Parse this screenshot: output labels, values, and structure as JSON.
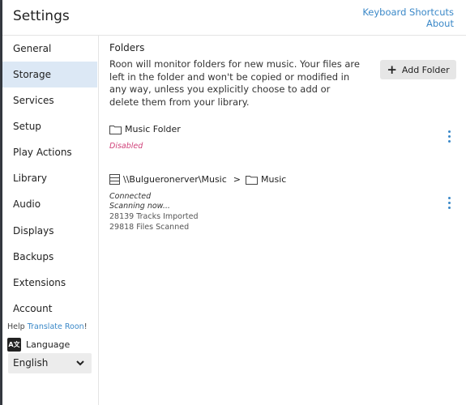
{
  "header": {
    "title": "Settings",
    "keyboard_shortcuts": "Keyboard Shortcuts",
    "about": "About"
  },
  "sidebar": {
    "items": [
      {
        "label": "General",
        "active": false
      },
      {
        "label": "Storage",
        "active": true
      },
      {
        "label": "Services",
        "active": false
      },
      {
        "label": "Setup",
        "active": false
      },
      {
        "label": "Play Actions",
        "active": false
      },
      {
        "label": "Library",
        "active": false
      },
      {
        "label": "Audio",
        "active": false
      },
      {
        "label": "Displays",
        "active": false
      },
      {
        "label": "Backups",
        "active": false
      },
      {
        "label": "Extensions",
        "active": false
      },
      {
        "label": "Account",
        "active": false
      }
    ],
    "help_prefix": "Help",
    "help_link": "Translate Roon",
    "help_suffix": "!",
    "language_label": "Language",
    "language_icon_text": "A文",
    "language_value": "English"
  },
  "main": {
    "section_title": "Folders",
    "description": "Roon will monitor folders for new music. Your files are left in the folder and won't be copied or modified in any way, unless you explicitly choose to add or delete them from your library.",
    "add_button_label": "Add Folder",
    "folders": [
      {
        "name": "Music Folder",
        "status": "Disabled"
      },
      {
        "server": "\\\\Bulgueronerver\\Music",
        "separator": ">",
        "name": "Music",
        "status": "Connected",
        "scanning": "Scanning now...",
        "tracks": "28139 Tracks Imported",
        "files": "29818 Files Scanned"
      }
    ]
  },
  "colors": {
    "accent": "#3a88c8",
    "active_bg": "#dce8f5",
    "disabled": "#d0427a"
  }
}
